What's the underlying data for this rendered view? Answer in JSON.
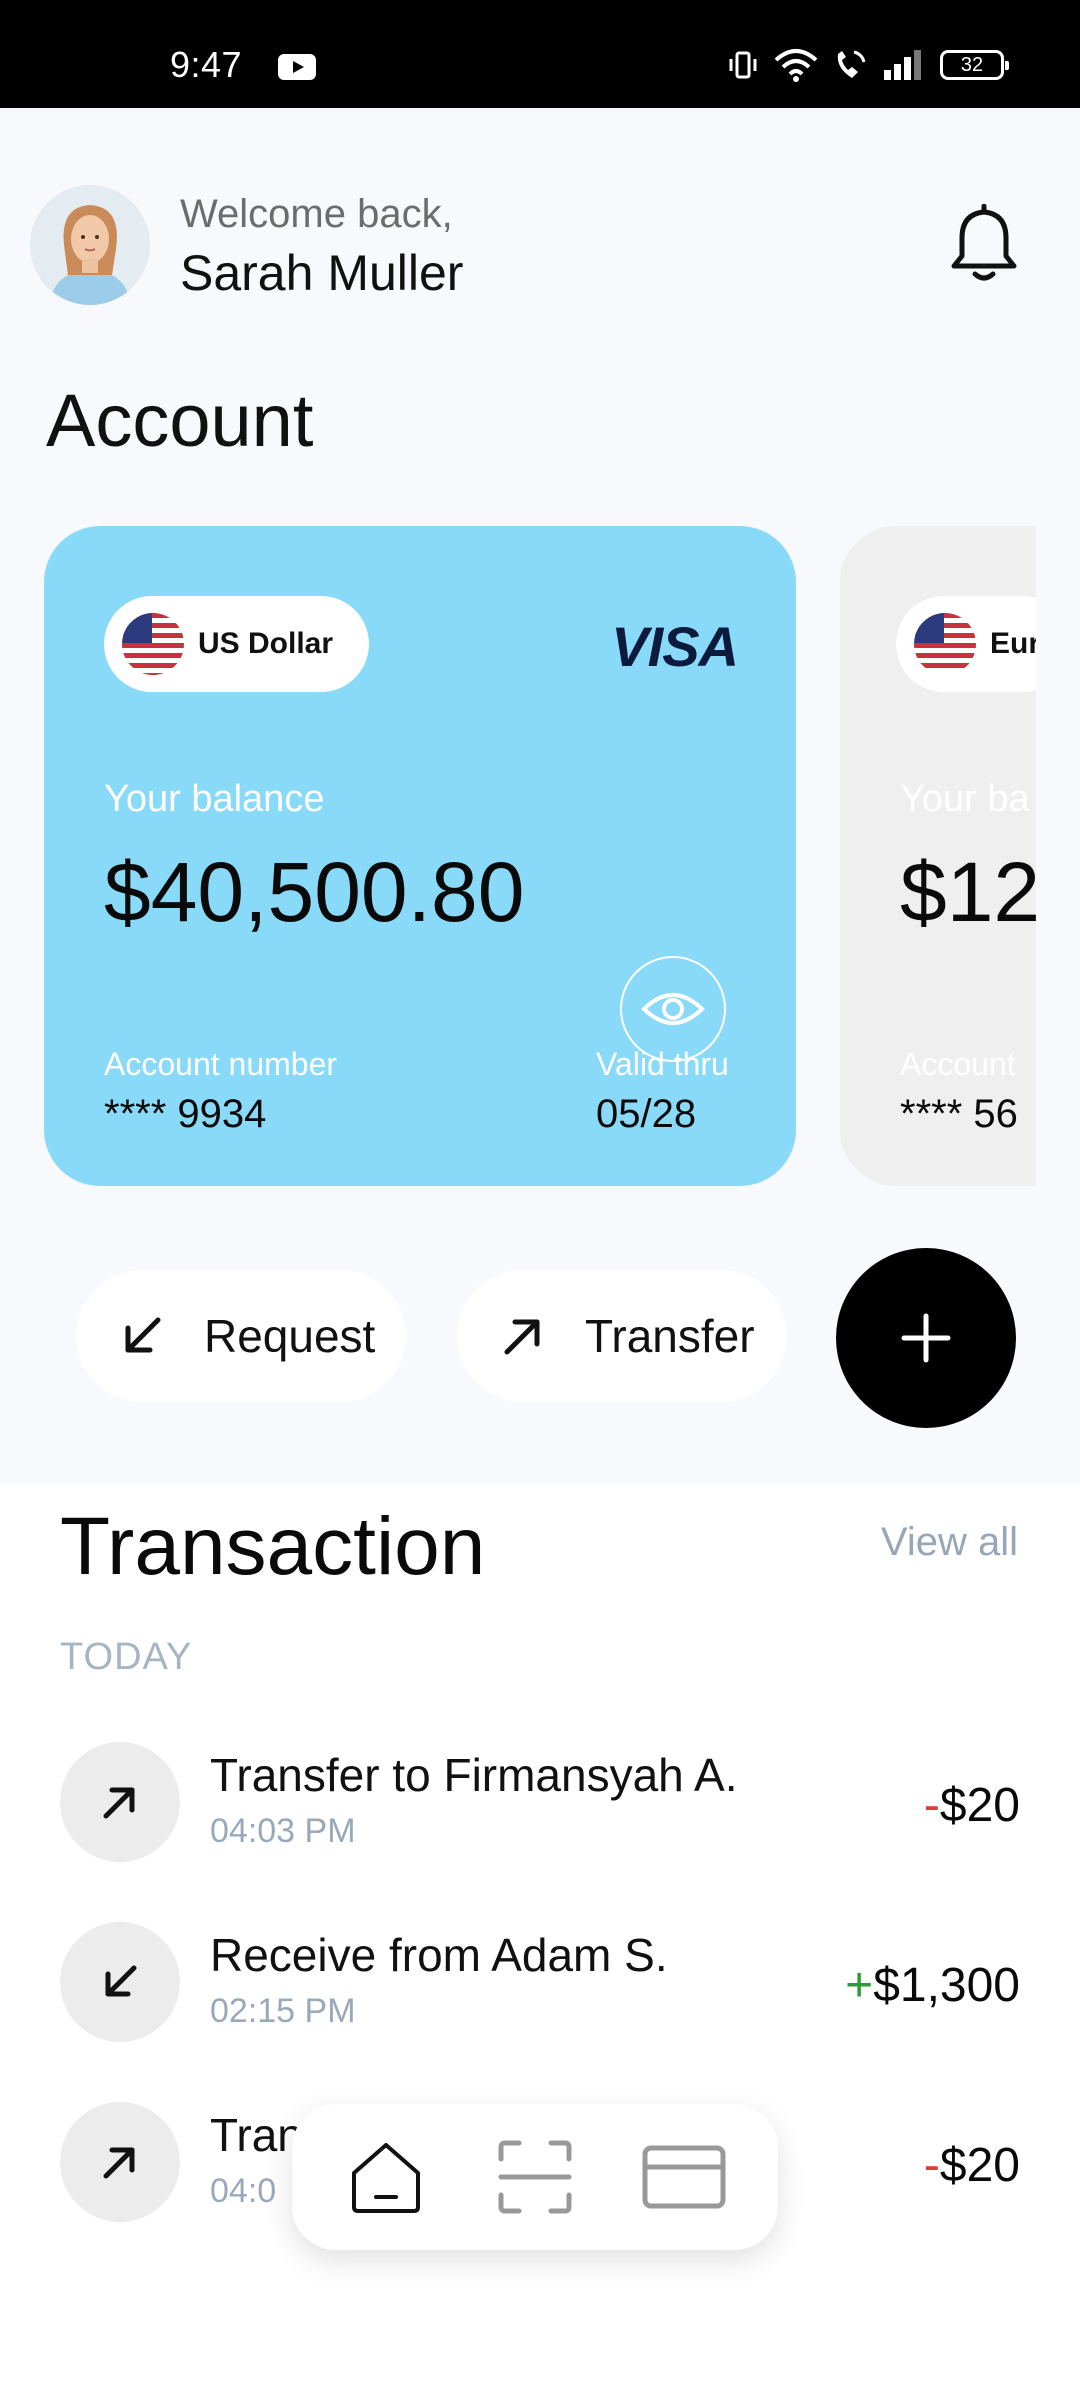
{
  "status_bar": {
    "time": "9:47",
    "battery": "32"
  },
  "header": {
    "welcome": "Welcome back,",
    "name": "Sarah Muller"
  },
  "account": {
    "title": "Account",
    "cards": [
      {
        "currency": "US Dollar",
        "brand": "VISA",
        "balance_label": "Your balance",
        "balance": "$40,500.80",
        "account_number_label": "Account number",
        "account_number": "**** 9934",
        "valid_label": "Valid thru",
        "valid_thru": "05/28",
        "color": "#89d9f8"
      },
      {
        "currency": "Eur",
        "balance_label": "Your ba",
        "balance": "$12",
        "account_number_label": "Account",
        "account_number": "**** 56",
        "color": "#efefef"
      }
    ]
  },
  "actions": {
    "request": "Request",
    "transfer": "Transfer"
  },
  "transactions": {
    "title": "Transaction",
    "view_all": "View all",
    "group_label": "TODAY",
    "items": [
      {
        "name": "Transfer to Firmansyah A.",
        "time": "04:03 PM",
        "sign": "-",
        "amount": "$20",
        "direction": "outgoing"
      },
      {
        "name": "Receive from Adam S.",
        "time": "02:15 PM",
        "sign": "+",
        "amount": "$1,300",
        "direction": "incoming"
      },
      {
        "name": "Tran",
        "time": "04:0",
        "sign": "-",
        "amount": "$20",
        "direction": "outgoing"
      }
    ]
  },
  "bottom_nav": {
    "items": [
      "home-icon",
      "scan-icon",
      "card-icon"
    ],
    "active": "home-icon"
  },
  "colors": {
    "accent_card": "#89d9f8",
    "negative": "#e53935",
    "positive": "#2e9b3a",
    "muted": "#98a7b8"
  }
}
